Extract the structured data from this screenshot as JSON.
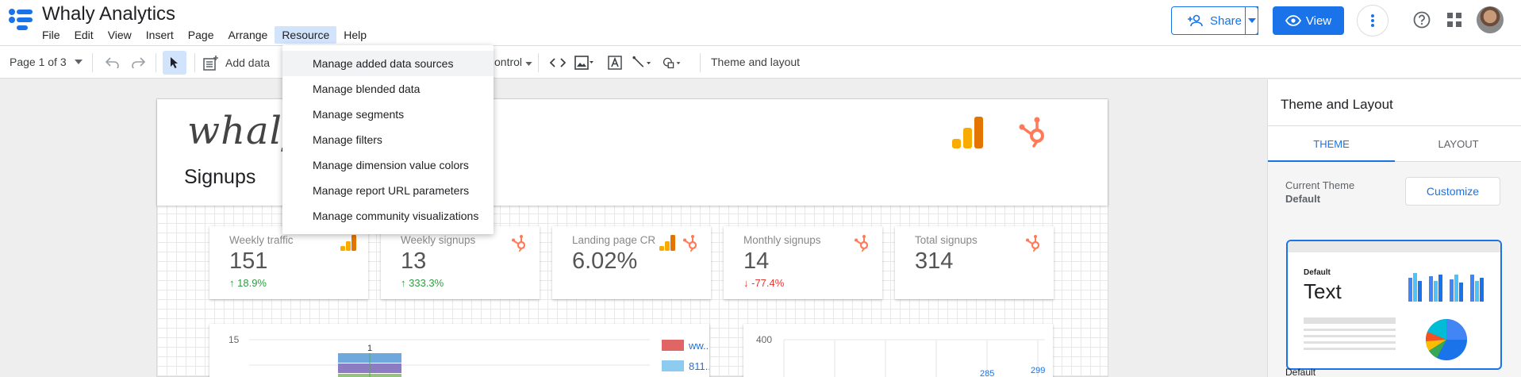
{
  "app": {
    "title": "Whaly Analytics"
  },
  "menu": [
    "File",
    "Edit",
    "View",
    "Insert",
    "Page",
    "Arrange",
    "Resource",
    "Help"
  ],
  "header_actions": {
    "share": "Share",
    "view": "View"
  },
  "toolbar": {
    "page_indicator": "Page 1 of 3",
    "add_data": "Add data",
    "control": "ontrol",
    "theme_layout": "Theme and layout"
  },
  "resource_menu": [
    "Manage added data sources",
    "Manage blended data",
    "Manage segments",
    "Manage filters",
    "Manage dimension value colors",
    "Manage report URL parameters",
    "Manage community visualizations"
  ],
  "report": {
    "logo_text": "whaly",
    "title": "Signups",
    "scorecards": [
      {
        "label": "Weekly traffic",
        "value": "151",
        "change": "18.9%",
        "direction": "up",
        "icons": [
          "analytics-icon"
        ]
      },
      {
        "label": "Weekly signups",
        "value": "13",
        "change": "333.3%",
        "direction": "up",
        "icons": [
          "hubspot-icon"
        ]
      },
      {
        "label": "Landing page CR",
        "value": "6.02%",
        "change": "",
        "direction": "",
        "icons": [
          "analytics-icon",
          "hubspot-icon"
        ]
      },
      {
        "label": "Monthly signups",
        "value": "14",
        "change": "-77.4%",
        "direction": "down",
        "icons": [
          "hubspot-icon"
        ]
      },
      {
        "label": "Total signups",
        "value": "314",
        "change": "",
        "direction": "",
        "icons": [
          "hubspot-icon"
        ]
      }
    ],
    "chart_left": {
      "y_tick": "15",
      "bar_label": "1",
      "legend": [
        "ww...",
        "811..."
      ],
      "legend_colors": [
        "#e06666",
        "#8ecbf0"
      ]
    },
    "chart_right": {
      "y_tick": "400",
      "labels": [
        "285",
        "299"
      ]
    }
  },
  "right_panel": {
    "title": "Theme and Layout",
    "tabs": [
      "THEME",
      "LAYOUT"
    ],
    "current_theme_label": "Current Theme",
    "current_theme_value": "Default",
    "customize": "Customize",
    "preview_label": "Default",
    "preview_text": "Text",
    "preview_caption": "Default"
  },
  "colors": {
    "accent": "#1a73e8",
    "up": "#2e9d3f",
    "down": "#e53935",
    "ga_orange": "#f9ab00",
    "hubspot": "#ff7a59"
  }
}
